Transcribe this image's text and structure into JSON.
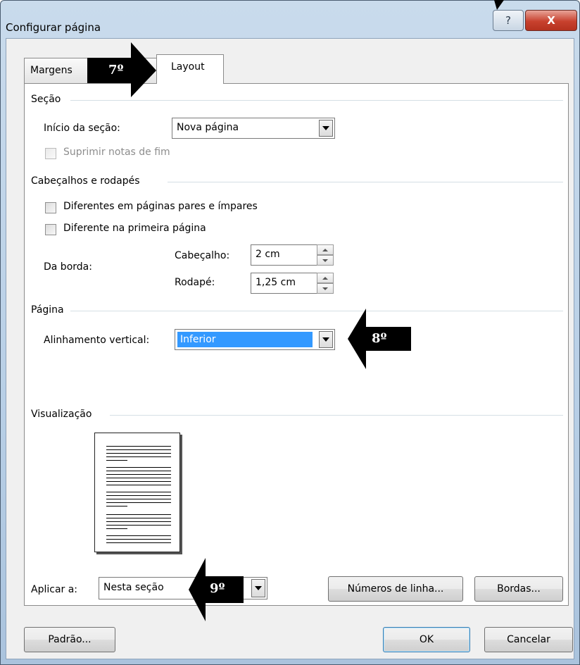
{
  "window": {
    "title": "Configurar página",
    "help_label": "?",
    "close_label": "X"
  },
  "tabs": [
    {
      "label": "Margens"
    },
    {
      "label": "Layout"
    }
  ],
  "section": {
    "header": "Seção",
    "start_label": "Início da seção:",
    "start_value": "Nova página",
    "suppress_endnotes": "Suprimir notas de fim"
  },
  "headers_footers": {
    "header": "Cabeçalhos e rodapés",
    "odd_even": "Diferentes em páginas pares e ímpares",
    "first_page": "Diferente na primeira página",
    "from_edge": "Da borda:",
    "header_label": "Cabeçalho:",
    "header_value": "2 cm",
    "footer_label": "Rodapé:",
    "footer_value": "1,25 cm"
  },
  "page": {
    "header": "Página",
    "vertical_align_label": "Alinhamento vertical:",
    "vertical_align_value": "Inferior"
  },
  "preview": {
    "header": "Visualização"
  },
  "apply": {
    "label": "Aplicar a:",
    "value": "Nesta seção"
  },
  "buttons": {
    "line_numbers": "Números de linha...",
    "borders": "Bordas...",
    "default": "Padrão...",
    "ok": "OK",
    "cancel": "Cancelar"
  },
  "annotations": {
    "step7": "7º",
    "step8": "8º",
    "step9": "9º"
  },
  "colors": {
    "selection": "#3399ff",
    "arrow": "#000000",
    "close": "#c8412e"
  }
}
